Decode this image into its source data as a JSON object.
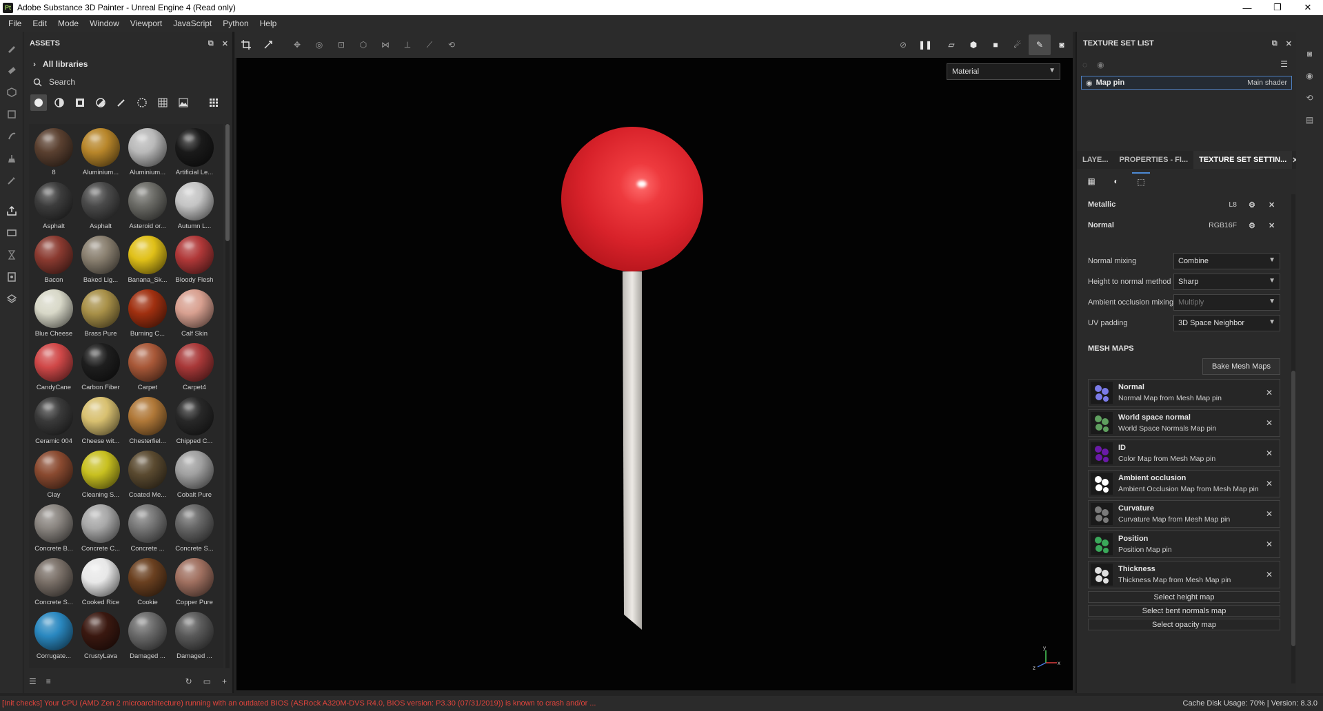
{
  "window": {
    "app_icon": "Pt",
    "title": "Adobe Substance 3D Painter - Unreal Engine 4 (Read only)",
    "minimize": "—",
    "maximize": "❐",
    "close": "✕"
  },
  "menu": [
    "File",
    "Edit",
    "Mode",
    "Window",
    "Viewport",
    "JavaScript",
    "Python",
    "Help"
  ],
  "assets": {
    "title": "ASSETS",
    "library": "All libraries",
    "search_placeholder": "Search",
    "items": [
      {
        "name": "8",
        "color": "#5a4030"
      },
      {
        "name": "Aluminium...",
        "color": "#b8862a"
      },
      {
        "name": "Aluminium...",
        "color": "#b9b9b9"
      },
      {
        "name": "Artificial Le...",
        "color": "#1a1a1a"
      },
      {
        "name": "Asphalt",
        "color": "#3c3c3c"
      },
      {
        "name": "Asphalt",
        "color": "#4a4a4a"
      },
      {
        "name": "Asteroid or...",
        "color": "#6b6b66"
      },
      {
        "name": "Autumn L...",
        "color": "#c4c4c4"
      },
      {
        "name": "Bacon",
        "color": "#8a3a30"
      },
      {
        "name": "Baked Lig...",
        "color": "#8a8070"
      },
      {
        "name": "Banana_Sk...",
        "color": "#e0c018"
      },
      {
        "name": "Bloody Flesh",
        "color": "#b03838"
      },
      {
        "name": "Blue Cheese",
        "color": "#d8d8c8"
      },
      {
        "name": "Brass Pure",
        "color": "#a89048"
      },
      {
        "name": "Burning C...",
        "color": "#a03010"
      },
      {
        "name": "Calf Skin",
        "color": "#d8a090"
      },
      {
        "name": "CandyCane",
        "color": "#d04848"
      },
      {
        "name": "Carbon Fiber",
        "color": "#1e1e1e"
      },
      {
        "name": "Carpet",
        "color": "#a85838"
      },
      {
        "name": "Carpet4",
        "color": "#a83838"
      },
      {
        "name": "Ceramic 004",
        "color": "#3a3a3a"
      },
      {
        "name": "Cheese wit...",
        "color": "#d8c070"
      },
      {
        "name": "Chesterfiel...",
        "color": "#b07838"
      },
      {
        "name": "Chipped C...",
        "color": "#282828"
      },
      {
        "name": "Clay",
        "color": "#8a4a30"
      },
      {
        "name": "Cleaning S...",
        "color": "#c8c020"
      },
      {
        "name": "Coated Me...",
        "color": "#5a4a30"
      },
      {
        "name": "Cobalt Pure",
        "color": "#a0a0a0"
      },
      {
        "name": "Concrete B...",
        "color": "#8a8580"
      },
      {
        "name": "Concrete C...",
        "color": "#a8a8a8"
      },
      {
        "name": "Concrete ...",
        "color": "#777777"
      },
      {
        "name": "Concrete S...",
        "color": "#666666"
      },
      {
        "name": "Concrete S...",
        "color": "#7a7068"
      },
      {
        "name": "Cooked Rice",
        "color": "#e8e8e8"
      },
      {
        "name": "Cookie",
        "color": "#6a4020"
      },
      {
        "name": "Copper Pure",
        "color": "#a07060"
      },
      {
        "name": "Corrugate...",
        "color": "#2a88c0"
      },
      {
        "name": "CrustyLava",
        "color": "#3a1810"
      },
      {
        "name": "Damaged ...",
        "color": "#6a6a6a"
      },
      {
        "name": "Damaged ...",
        "color": "#5a5a5a"
      }
    ]
  },
  "viewport": {
    "material_mode": "Material",
    "axis_y": "y",
    "axis_x": "x",
    "axis_z": "z"
  },
  "texture_set_list": {
    "title": "TEXTURE SET LIST",
    "set_name": "Map pin",
    "shader": "Main shader"
  },
  "tabs": [
    "LAYE...",
    "PROPERTIES - FI...",
    "TEXTURE SET SETTIN..."
  ],
  "channels": [
    {
      "name": "Metallic",
      "format": "L8"
    },
    {
      "name": "Normal",
      "format": "RGB16F"
    }
  ],
  "properties": [
    {
      "label": "Normal mixing",
      "value": "Combine",
      "disabled": false
    },
    {
      "label": "Height to normal method",
      "value": "Sharp",
      "disabled": false
    },
    {
      "label": "Ambient occlusion mixing",
      "value": "Multiply",
      "disabled": true
    },
    {
      "label": "UV padding",
      "value": "3D Space Neighbor",
      "disabled": false
    }
  ],
  "mesh_maps": {
    "title": "MESH MAPS",
    "bake_label": "Bake Mesh Maps",
    "items": [
      {
        "title": "Normal",
        "subtitle": "Normal Map from Mesh Map pin",
        "color": "#7b7be8"
      },
      {
        "title": "World space normal",
        "subtitle": "World Space Normals Map pin",
        "color": "#5fa05f"
      },
      {
        "title": "ID",
        "subtitle": "Color Map from Mesh Map pin",
        "color": "#6a1aa8"
      },
      {
        "title": "Ambient occlusion",
        "subtitle": "Ambient Occlusion Map from Mesh Map pin",
        "color": "#ffffff"
      },
      {
        "title": "Curvature",
        "subtitle": "Curvature Map from Mesh Map pin",
        "color": "#7a7a7a"
      },
      {
        "title": "Position",
        "subtitle": "Position Map pin",
        "color": "#3aa85a"
      },
      {
        "title": "Thickness",
        "subtitle": "Thickness Map from Mesh Map pin",
        "color": "#e0e0e0"
      }
    ],
    "select_buttons": [
      "Select height map",
      "Select bent normals map",
      "Select opacity map"
    ]
  },
  "status": {
    "message": "[Init checks] Your CPU (AMD Zen 2 microarchitecture) running with an outdated BIOS (ASRock A320M-DVS R4.0, BIOS version: P3.30 (07/31/2019)) is known to crash and/or ...",
    "info": "Cache Disk Usage:   70% | Version: 8.3.0"
  }
}
